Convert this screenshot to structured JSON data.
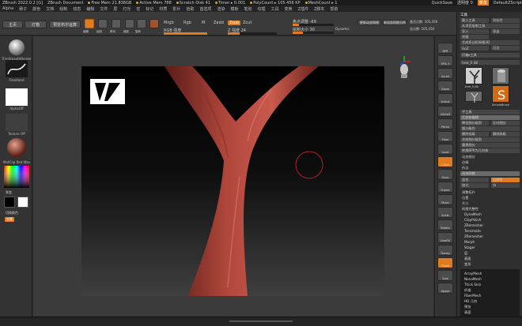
{
  "titlebar": {
    "items": [
      "ZBrush 2022.0.2 [G]",
      "ZBrush Document",
      "Free Mem 21.838GB",
      "Active Mem 788",
      "Scratch Disk 41",
      "Timer ▸ 0.001",
      "PolyCount ▸ 105.456 KP",
      "MeshCount ▸ 1"
    ],
    "quicksave": "QuickSave",
    "see_through": "透明度 0",
    "menus_label": "菜单",
    "default_script": "DefaultZScript"
  },
  "menubar": [
    "Alpha",
    "刷子",
    "颜色",
    "文档",
    "绘制",
    "动态",
    "编辑",
    "文件",
    "层",
    "灯光",
    "宏",
    "标记",
    "材质",
    "影片",
    "拾取",
    "首选项",
    "渲染",
    "模板",
    "笔划",
    "纹理",
    "工具",
    "变换",
    "Z插件",
    "Z脚本",
    "帮助"
  ],
  "topshelf": {
    "home": "主页",
    "lightbox": "灯箱",
    "live_boolean": "预览布尔运算",
    "tools": [
      "编辑",
      "绘制",
      "移动",
      "缩放",
      "旋转"
    ],
    "mrgb": "Mrgb",
    "rgb": "Rgb",
    "m": "M",
    "zadd": "Zadd",
    "zsub": "Zsub",
    "zcut": "Zcut",
    "rgb_intensity": "RGB 强度",
    "z_intensity": "Z 强度 24",
    "focal_shift": "焦点调整 -69",
    "draw_size": "绘制大小 30",
    "dynamic": "Dynamic",
    "active_points": "激活点数: 105,456",
    "total_points": "总点数: 105,456",
    "dynamesh_btn1": "更新动态网格",
    "dynamesh_btn2": "更新动态网格分辨率"
  },
  "lefttray": {
    "brushes": [
      {
        "name": "TrimSmoothBorder"
      },
      {
        "name": "FreeHand"
      },
      {
        "name": "AlphaOff"
      },
      {
        "name": "Texture Off"
      },
      {
        "name": "RedWax"
      },
      {
        "name": "MatCap Red Wax"
      }
    ],
    "gradient": "渐变",
    "switch_color": "切换颜色",
    "alternate": "交替"
  },
  "canvas": {
    "brush_cursor": "draw-size-circle"
  },
  "rightshelf": [
    "BPR",
    "SPix 3",
    "Scroll",
    "Zoom",
    "Actual",
    "AAHalf",
    "Persp",
    "Floor",
    "Local",
    "L.Sym",
    "Gxyz",
    "Frame",
    "Move",
    "Scale",
    "Rotate",
    "LineFill",
    "PolyF",
    "Transp",
    "Ghost",
    "Solo",
    "Xpose"
  ],
  "tray": {
    "title": "工具",
    "load": "载入工具",
    "save": "另存为",
    "copy_tool": "从项目复制工具",
    "import": "导入",
    "export": "导出",
    "clone": "克隆",
    "make_polymesh": "生成多边形网格3D",
    "goz": "GoZ",
    "all": "所有",
    "visible": "可见",
    "r": "R",
    "lightbox_tools": "灯箱▸工具",
    "tree_name": "tree_5",
    "tree_count": "48",
    "thumbs": [
      "tree_5:48",
      "Cylinder3D",
      "SimpleBrush",
      "tree_5:48"
    ],
    "subtool": "子工具",
    "geometry": "几何体编辑",
    "lower_res": "降低细分级别",
    "higher_res": "反向细分",
    "subdiv_level": "细分级别",
    "del_lower": "删除低级",
    "del_higher": "删除高级",
    "freeze": "冻结细分级别",
    "reconstruct": "重建细分",
    "convert_bpr": "转换BPR为几何体",
    "dynamic_subdiv": "动态细分",
    "edge_loop": "边缘",
    "crease": "折边",
    "dynamesh": "动态网格",
    "blur": "混合",
    "resolution": "分辨率",
    "size_label": "节",
    "polish": "抛光",
    "modify_topology": "调整拓扑",
    "position": "位置",
    "size": "大小",
    "mesh_integrity": "网格完整性",
    "list": [
      "DynaMesh",
      "ClayPolish",
      "ZRemesher",
      "Tessimate",
      "ZRemesher",
      "Morph",
      "Stager",
      "层",
      "表面",
      "变形"
    ],
    "list2": [
      "ArrayMesh",
      "NanoMesh",
      "Thick Skin",
      "纤维",
      "FiberMesh",
      "HD 几何",
      "预览",
      "表面",
      "变形",
      "遮罩"
    ]
  },
  "colors": {
    "accent": "#e07b1f",
    "tree": "#b0463c",
    "canvas_top": "#000000",
    "canvas_bottom": "#3f3f3f"
  }
}
